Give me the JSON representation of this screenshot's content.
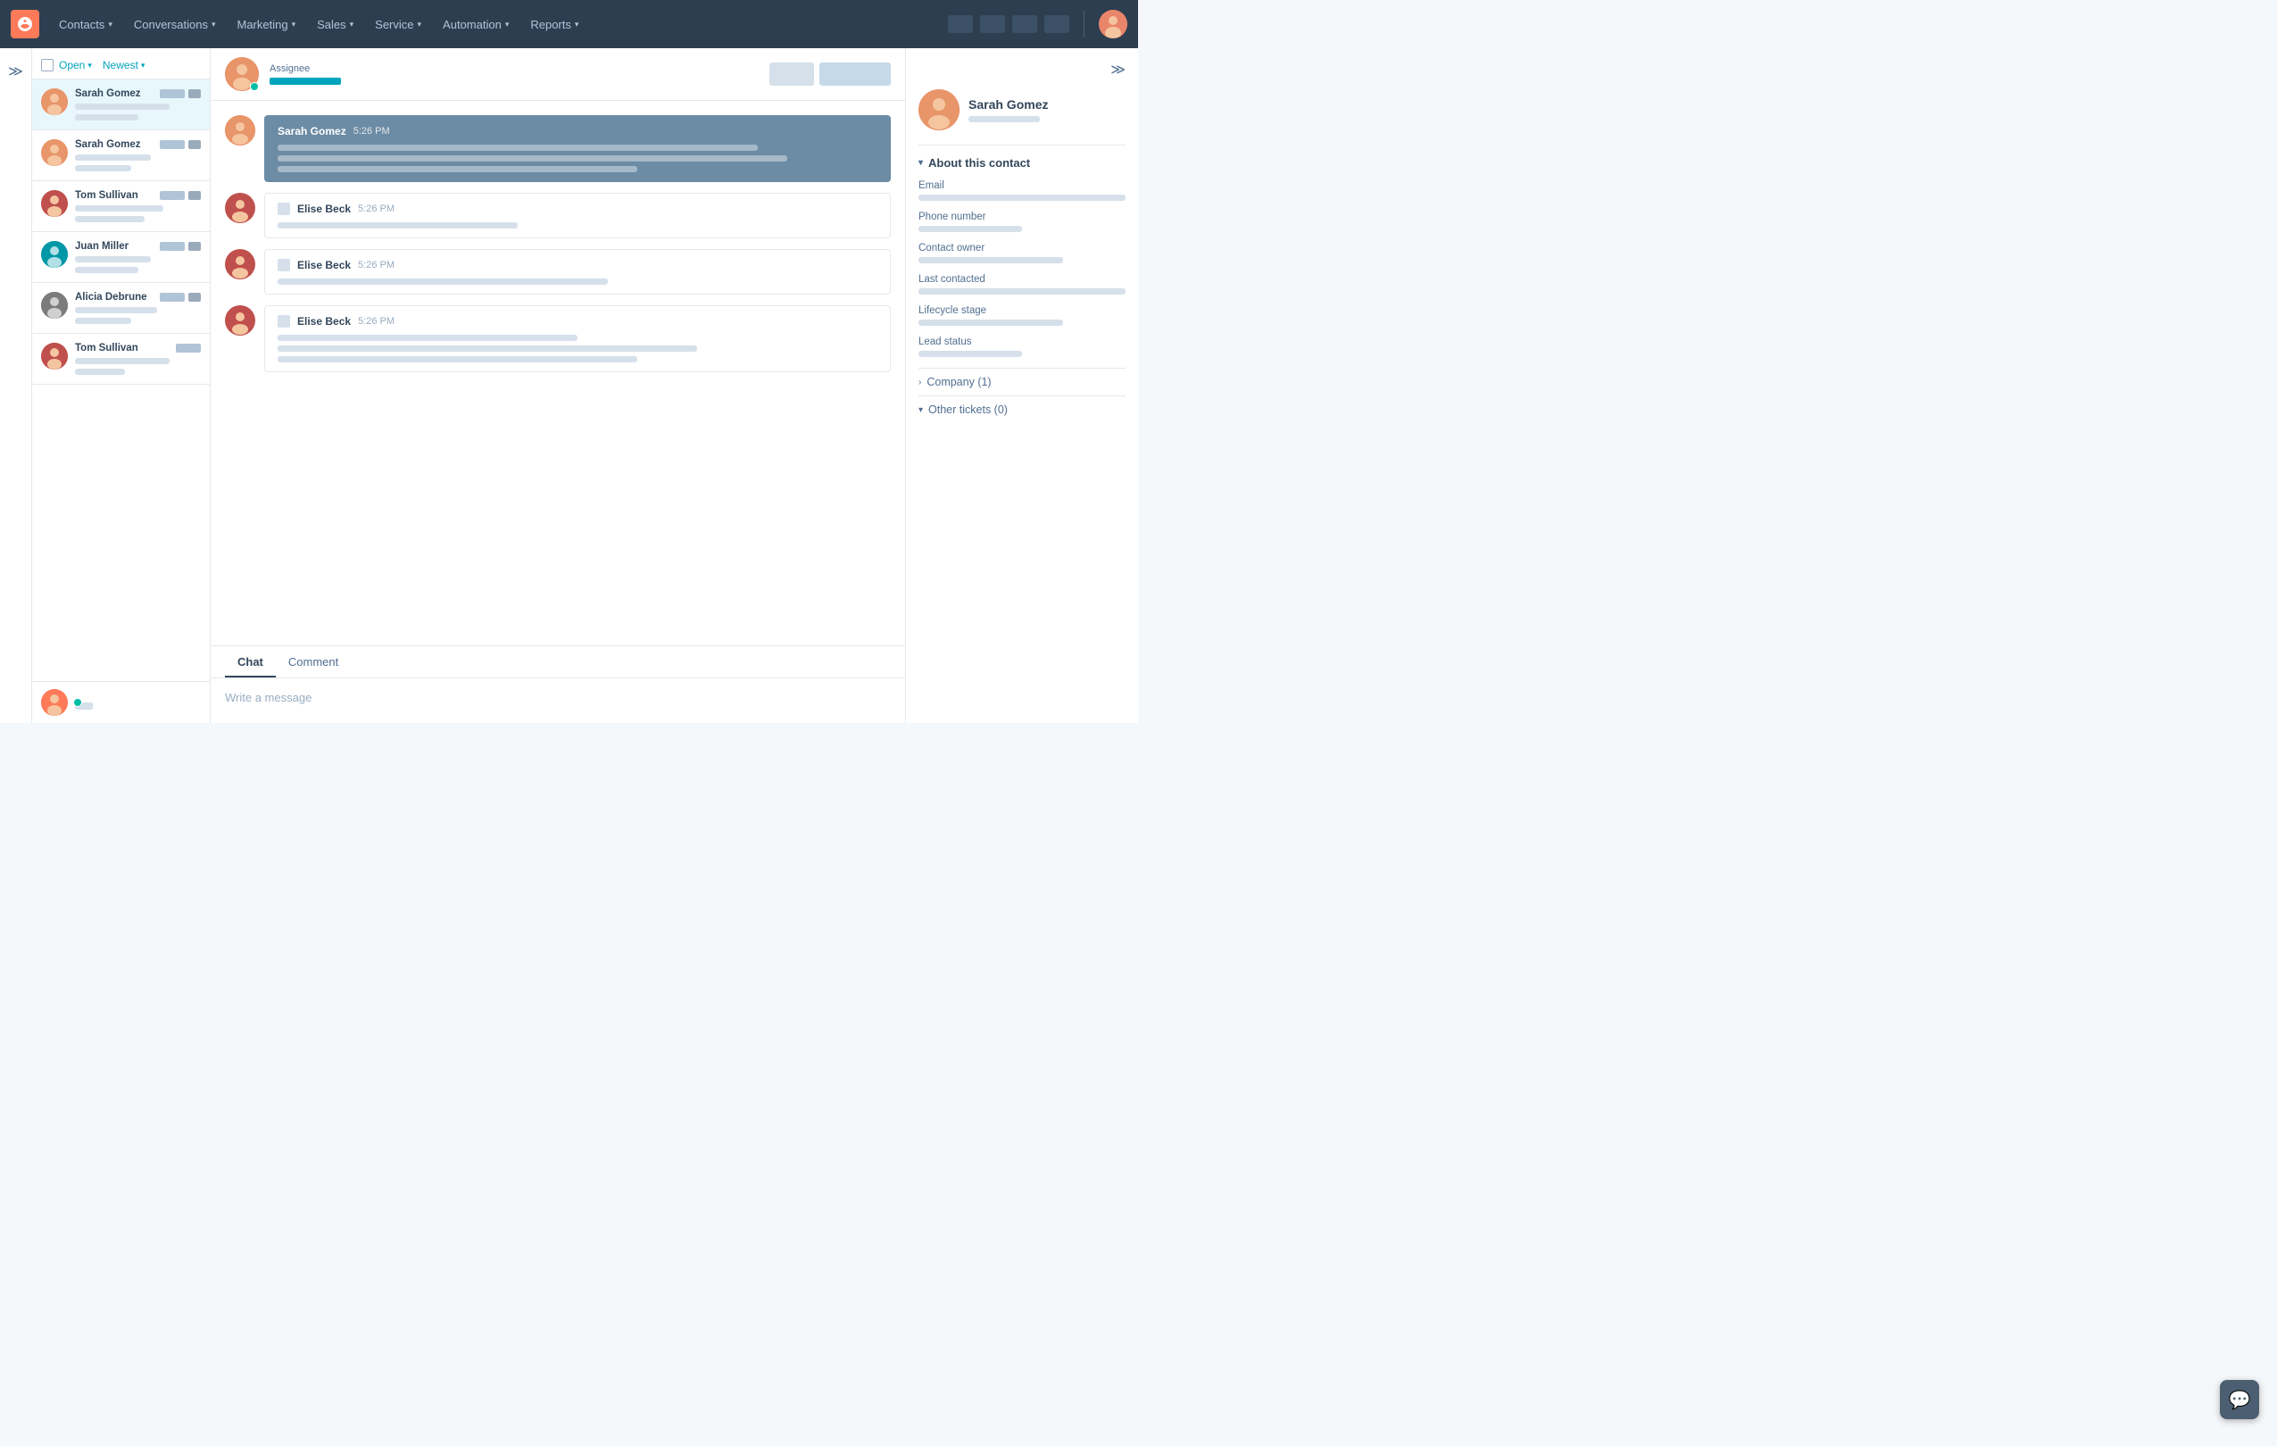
{
  "nav": {
    "logo_label": "H",
    "items": [
      {
        "label": "Contacts",
        "id": "contacts"
      },
      {
        "label": "Conversations",
        "id": "conversations"
      },
      {
        "label": "Marketing",
        "id": "marketing"
      },
      {
        "label": "Sales",
        "id": "sales"
      },
      {
        "label": "Service",
        "id": "service"
      },
      {
        "label": "Automation",
        "id": "automation"
      },
      {
        "label": "Reports",
        "id": "reports"
      }
    ]
  },
  "conv_list": {
    "filter_open": "Open",
    "filter_newest": "Newest",
    "conversations": [
      {
        "name": "Sarah Gomez",
        "avatar_class": "avatar-sg",
        "active": true
      },
      {
        "name": "Sarah Gomez",
        "avatar_class": "avatar-sg",
        "active": false
      },
      {
        "name": "Tom Sullivan",
        "avatar_class": "avatar-ts",
        "active": false
      },
      {
        "name": "Juan Miller",
        "avatar_class": "avatar-jm",
        "active": false
      },
      {
        "name": "Alicia Debrune",
        "avatar_class": "avatar-ad",
        "active": false
      },
      {
        "name": "Tom Sullivan",
        "avatar_class": "avatar-ts",
        "active": false
      }
    ]
  },
  "chat": {
    "assignee_label": "Assignee",
    "messages": [
      {
        "sender": "Sarah Gomez",
        "time": "5:26 PM",
        "type": "sent",
        "avatar_class": "avatar-sg"
      },
      {
        "sender": "Elise Beck",
        "time": "5:26 PM",
        "type": "received",
        "avatar_class": "avatar-ts"
      },
      {
        "sender": "Elise Beck",
        "time": "5:26 PM",
        "type": "received",
        "avatar_class": "avatar-ts"
      },
      {
        "sender": "Elise Beck",
        "time": "5:26 PM",
        "type": "received",
        "avatar_class": "avatar-ts"
      }
    ],
    "tabs": [
      {
        "label": "Chat",
        "id": "chat",
        "active": true
      },
      {
        "label": "Comment",
        "id": "comment",
        "active": false
      }
    ],
    "input_placeholder": "Write a message"
  },
  "right_panel": {
    "contact_name": "Sarah Gomez",
    "section_about": "About this contact",
    "fields": [
      {
        "label": "Email",
        "width": "fv-long"
      },
      {
        "label": "Phone number",
        "width": "fv-short"
      },
      {
        "label": "Contact owner",
        "width": "fv-med"
      },
      {
        "label": "Last contacted",
        "width": "fv-long"
      },
      {
        "label": "Lifecycle stage",
        "width": "fv-med"
      },
      {
        "label": "Lead status",
        "width": "fv-short"
      }
    ],
    "expandable": [
      {
        "label": "Company (1)"
      },
      {
        "label": "Other tickets (0)"
      }
    ]
  }
}
